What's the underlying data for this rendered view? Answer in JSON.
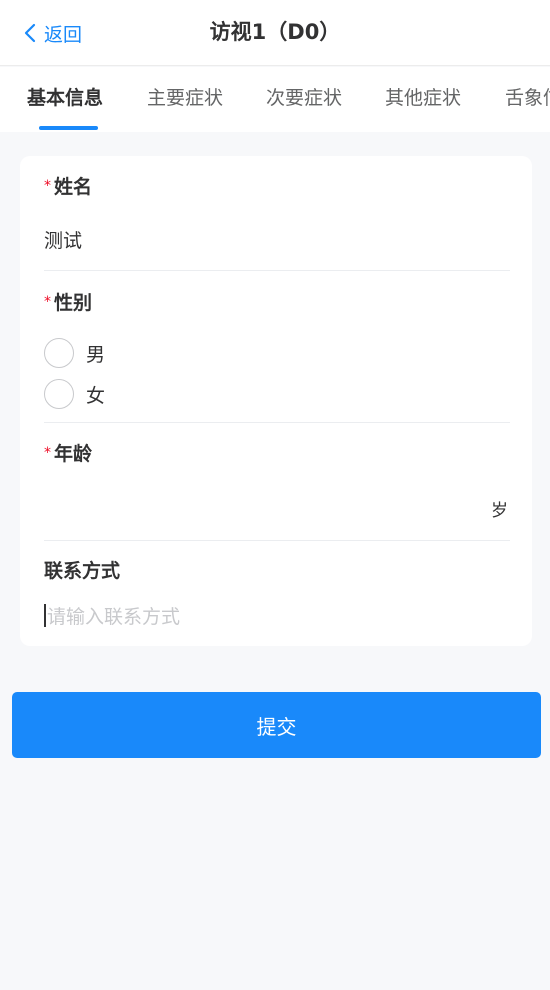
{
  "nav": {
    "back_label": "返回",
    "title": "访视1（D0）"
  },
  "tabs": [
    {
      "label": "基本信息"
    },
    {
      "label": "主要症状"
    },
    {
      "label": "次要症状"
    },
    {
      "label": "其他症状"
    },
    {
      "label": "舌象信息"
    }
  ],
  "form": {
    "required_mark": "*",
    "name": {
      "label": "姓名",
      "value": "测试"
    },
    "gender": {
      "label": "性别",
      "options": [
        "男",
        "女"
      ]
    },
    "age": {
      "label": "年龄",
      "unit": "岁"
    },
    "contact": {
      "label": "联系方式",
      "placeholder": "请输入联系方式"
    }
  },
  "submit_label": "提交"
}
